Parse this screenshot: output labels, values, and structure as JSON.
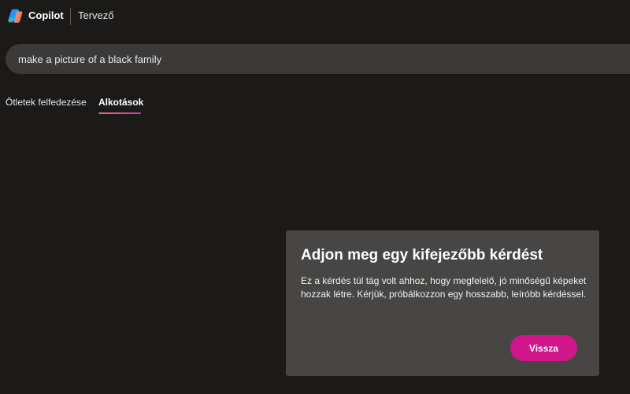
{
  "header": {
    "brand": "Copilot",
    "product": "Tervező",
    "logo_icon": "copilot-logo-icon"
  },
  "search": {
    "value": "make a picture of a black family"
  },
  "tabs": [
    {
      "label": "Ötletek felfedezése",
      "active": false
    },
    {
      "label": "Alkotások",
      "active": true
    }
  ],
  "dialog": {
    "title": "Adjon meg egy kifejezőbb kérdést",
    "body": "Ez a kérdés túl tág volt ahhoz, hogy megfelelő, jó minőségű képeket hozzak létre. Kérjük, próbálkozzon egy hosszabb, leíróbb kérdéssel.",
    "button_label": "Vissza"
  },
  "colors": {
    "background": "#1b1a19",
    "search_bg": "#3b3a39",
    "dialog_bg": "#474645",
    "accent": "#d1168a"
  }
}
